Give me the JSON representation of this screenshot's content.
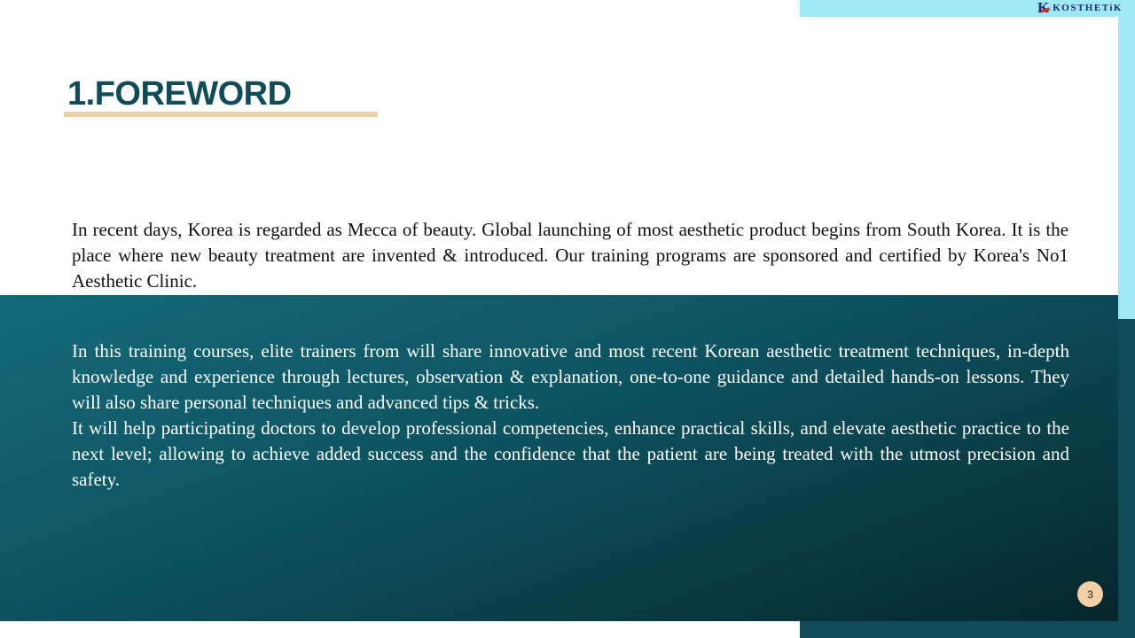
{
  "brand": {
    "logo_letter": "K",
    "logo_text": "KOSTHETiK"
  },
  "slide": {
    "title": "1.FOREWORD",
    "intro": "In recent days, Korea is regarded as Mecca of beauty. Global launching of most aesthetic product begins from South Korea. It is the place where new beauty treatment are invented & introduced. Our training programs are sponsored and certified by Korea's No1 Aesthetic Clinic.",
    "body": [
      "In this training courses, elite trainers from will share innovative and most recent Korean aesthetic treatment techniques, in-depth knowledge and experience through lectures, observation & explanation, one-to-one guidance and detailed hands-on lessons. They will also share personal techniques and advanced tips & tricks.",
      "It will help participating doctors to develop professional competencies, enhance practical skills, and elevate aesthetic practice to the next level; allowing to achieve added success and the confidence that the patient are being treated with the utmost precision and safety."
    ],
    "page_number": "3"
  },
  "colors": {
    "accent_light": "#9fe9f7",
    "accent_dark": "#0f4c57",
    "title": "#0f4c57",
    "underline": "#ebd0a8",
    "badge": "#f2cfa4"
  }
}
